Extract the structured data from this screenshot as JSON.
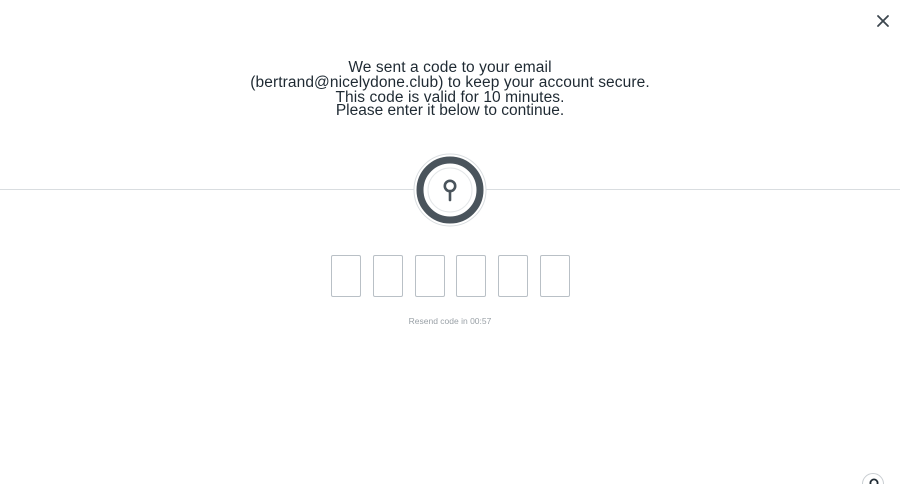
{
  "dialog": {
    "close_icon": "close-icon",
    "message": "We sent a code to your email (bertrand@nicelydone.club) to keep your account secure. This code is valid for 10 minutes.",
    "instruction": "Please enter it below to continue.",
    "badge_icon": "key-icon",
    "code_length": 6,
    "resend_label": "Resend code in 00:57"
  },
  "help": {
    "icon": "help-icon"
  },
  "colors": {
    "text": "#1f2a33",
    "muted": "#9aa1a7",
    "badge_ring": "#4a545c",
    "border": "#b9c0c6"
  }
}
